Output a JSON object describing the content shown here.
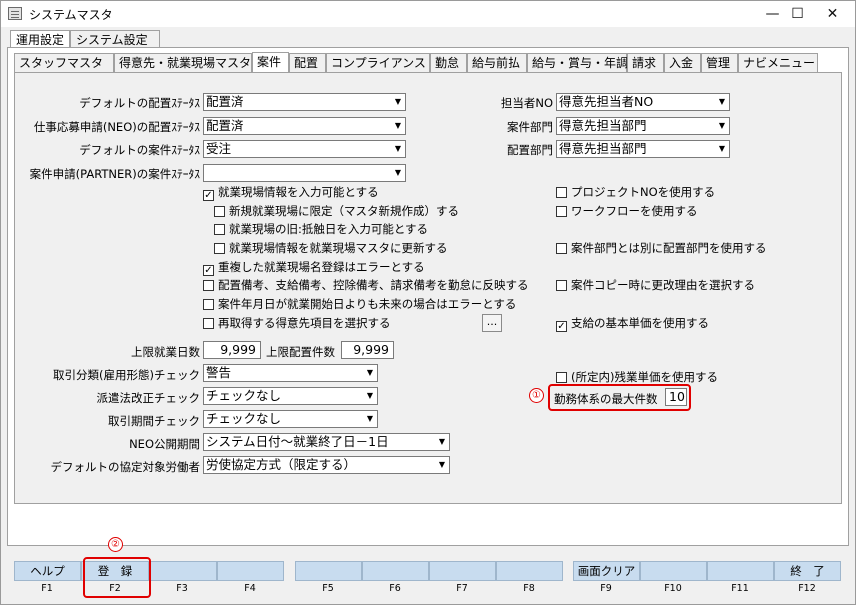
{
  "window": {
    "title": "システムマスタ",
    "minimize": "—",
    "maximize": "☐",
    "close": "✕"
  },
  "top_tabs": [
    {
      "label": "運用設定",
      "active": true
    },
    {
      "label": "システム設定",
      "active": false
    }
  ],
  "sub_tabs": [
    "スタッフマスタ",
    "得意先・就業現場マスタ",
    "案件",
    "配置",
    "コンプライアンス",
    "勤怠",
    "給与前払",
    "給与・賞与・年調",
    "請求",
    "入金",
    "管理",
    "ナビメニュー"
  ],
  "sub_tab_active": "案件",
  "left_fields": [
    {
      "label": "デフォルトの配置ｽﾃｰﾀｽ",
      "value": "配置済"
    },
    {
      "label": "仕事応募申請(NEO)の配置ｽﾃｰﾀｽ",
      "value": "配置済"
    },
    {
      "label": "デフォルトの案件ｽﾃｰﾀｽ",
      "value": "受注"
    },
    {
      "label": "案件申請(PARTNER)の案件ｽﾃｰﾀｽ",
      "value": ""
    }
  ],
  "right_fields": [
    {
      "label": "担当者NO",
      "value": "得意先担当者NO"
    },
    {
      "label": "案件部門",
      "value": "得意先担当部門"
    },
    {
      "label": "配置部門",
      "value": "得意先担当部門"
    }
  ],
  "checks_left": [
    {
      "label": "就業現場情報を入力可能とする",
      "checked": true
    },
    {
      "label": "新規就業現場に限定（マスタ新規作成）する",
      "checked": false
    },
    {
      "label": "就業現場の旧:抵触日を入力可能とする",
      "checked": false
    },
    {
      "label": "就業現場情報を就業現場マスタに更新する",
      "checked": false
    },
    {
      "label": "重複した就業現場名登録はエラーとする",
      "checked": true
    },
    {
      "label": "配置備考、支給備考、控除備考、請求備考を勤怠に反映する",
      "checked": false
    },
    {
      "label": "案件年月日が就業開始日よりも未来の場合はエラーとする",
      "checked": false
    },
    {
      "label": "再取得する得意先項目を選択する",
      "checked": false
    }
  ],
  "dots_button": "...",
  "checks_right": [
    {
      "label": "プロジェクトNOを使用する",
      "checked": false
    },
    {
      "label": "ワークフローを使用する",
      "checked": false
    },
    {
      "label": "案件部門とは別に配置部門を使用する",
      "checked": false
    },
    {
      "label": "案件コピー時に更改理由を選択する",
      "checked": false
    },
    {
      "label": "支給の基本単価を使用する",
      "checked": true
    },
    {
      "label": "(所定内)残業単価を使用する",
      "checked": false
    }
  ],
  "limits": {
    "work_days_label": "上限就業日数",
    "work_days": "9,999",
    "assign_count_label": "上限配置件数",
    "assign_count": "9,999"
  },
  "lower_fields": [
    {
      "label": "取引分類(雇用形態)チェック",
      "value": "警告"
    },
    {
      "label": "派遣法改正チェック",
      "value": "チェックなし"
    },
    {
      "label": "取引期間チェック",
      "value": "チェックなし"
    },
    {
      "label": "NEO公開期間",
      "value": "システム日付～就業終了日－1日"
    },
    {
      "label": "デフォルトの協定対象労働者",
      "value": "労使協定方式（限定する）"
    }
  ],
  "max_work_system": {
    "label": "勤務体系の最大件数",
    "value": "10"
  },
  "annotations": {
    "one": "①",
    "two": "②"
  },
  "fkeys": [
    {
      "key": "F1",
      "label": "ヘルプ"
    },
    {
      "key": "F2",
      "label": "登　録"
    },
    {
      "key": "F3",
      "label": ""
    },
    {
      "key": "F4",
      "label": ""
    },
    {
      "key": "F5",
      "label": ""
    },
    {
      "key": "F6",
      "label": ""
    },
    {
      "key": "F7",
      "label": ""
    },
    {
      "key": "F8",
      "label": ""
    },
    {
      "key": "F9",
      "label": "画面クリア"
    },
    {
      "key": "F10",
      "label": ""
    },
    {
      "key": "F11",
      "label": ""
    },
    {
      "key": "F12",
      "label": "終　了"
    }
  ],
  "colors": {
    "annotation": "#e00000",
    "fkey_bg": "#c8dcef"
  }
}
